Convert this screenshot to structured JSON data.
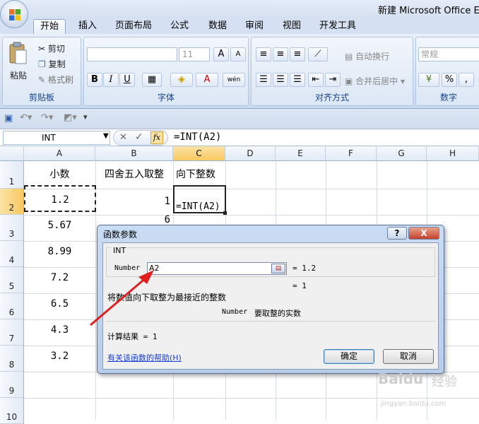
{
  "window": {
    "title": "新建 Microsoft Office Exc"
  },
  "tabs": [
    "开始",
    "插入",
    "页面布局",
    "公式",
    "数据",
    "审阅",
    "视图",
    "开发工具"
  ],
  "ribbon": {
    "clipboard": {
      "paste": "粘贴",
      "cut": "剪切",
      "copy": "复制",
      "format_painter": "格式刷",
      "label": "剪贴板"
    },
    "font": {
      "size": "11",
      "bold": "B",
      "italic": "I",
      "underline": "U",
      "grow": "A",
      "shrink": "A",
      "label": "字体"
    },
    "alignment": {
      "wrap": "自动换行",
      "merge": "合并后居中",
      "label": "对齐方式"
    },
    "number": {
      "format": "常规",
      "percent": "%",
      "label": "数字"
    }
  },
  "formula_bar": {
    "name_box": "INT",
    "fx": "fx",
    "formula": "=INT(A2)"
  },
  "columns": [
    "A",
    "B",
    "C",
    "D",
    "E",
    "F",
    "G",
    "H"
  ],
  "rows": [
    "1",
    "2",
    "3",
    "4",
    "5",
    "6",
    "7",
    "8",
    "9",
    "10"
  ],
  "cells": {
    "A1": "小数",
    "B1": "四舍五入取整",
    "C1": "向下整数",
    "A2": "1.2",
    "A3": "5.67",
    "A4": "8.99",
    "A5": "7.2",
    "A6": "6.5",
    "A7": "4.3",
    "A8": "3.2",
    "B2": "1",
    "B3": "6",
    "C2": "=INT(A2)"
  },
  "dialog": {
    "title": "函数参数",
    "help_btn": "?",
    "close_btn": "X",
    "function_name": "INT",
    "arg_label": "Number",
    "arg_value": "A2",
    "arg_result": "= 1.2",
    "func_result": "= 1",
    "description": "将数值向下取整为最接近的整数",
    "arg_desc_name": "Number",
    "arg_desc": "要取整的实数",
    "calc_result": "计算结果 = 1",
    "help_link": "有关该函数的帮助(H)",
    "ok": "确定",
    "cancel": "取消"
  },
  "watermark": {
    "brand": "Baidu",
    "sub": "经验",
    "url": "jingyan.baidu.com"
  }
}
